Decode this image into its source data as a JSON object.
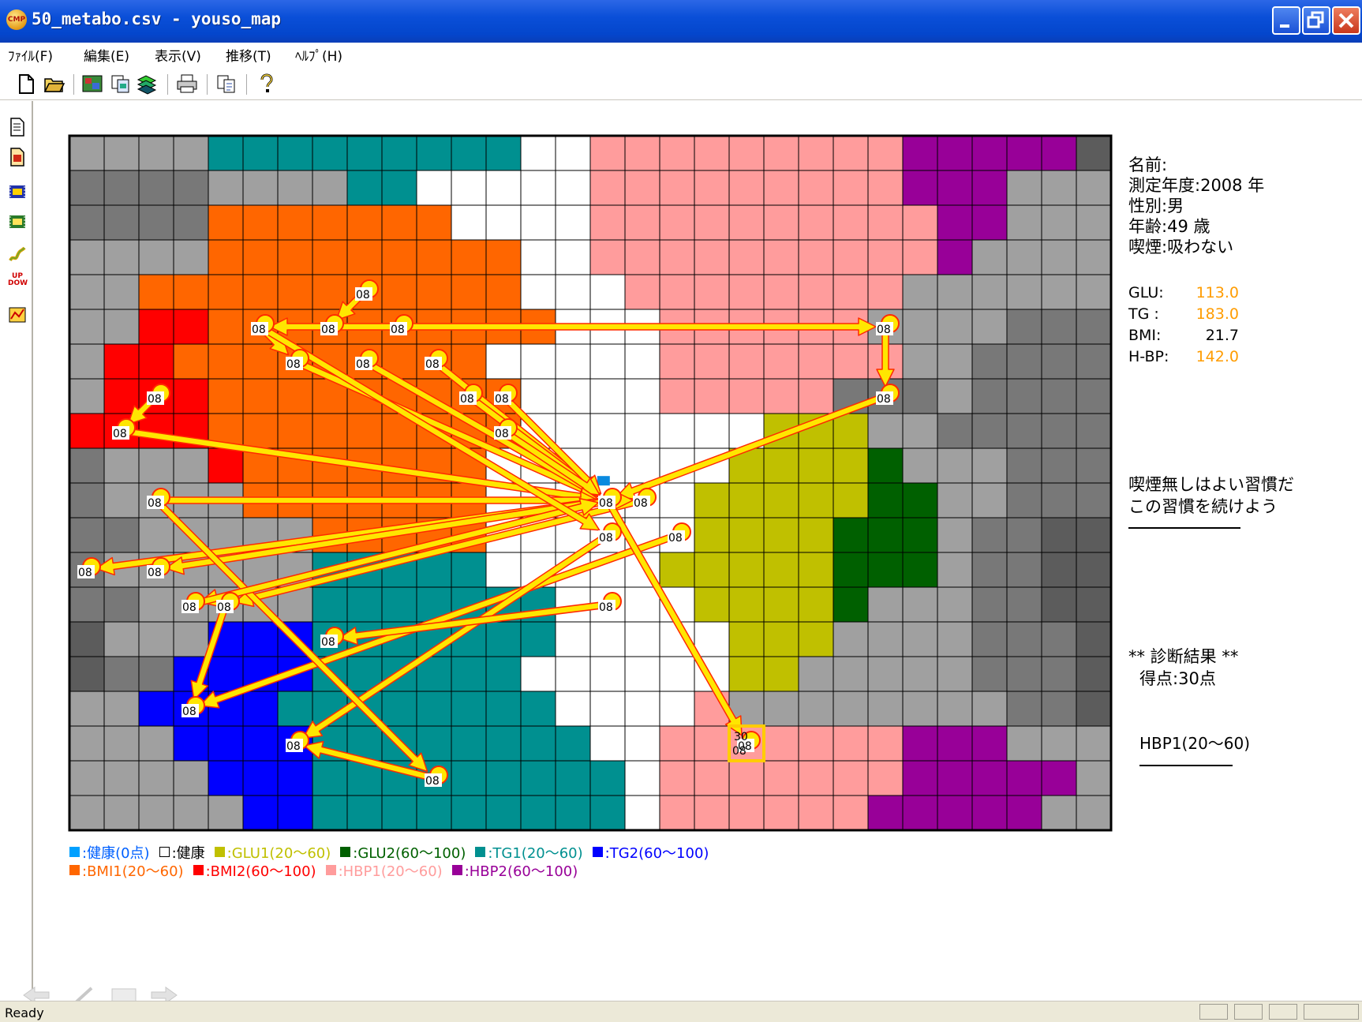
{
  "window": {
    "title": "50_metabo.csv - youso_map",
    "icon": "CMP"
  },
  "menu": [
    "ﾌｧｲﾙ(F)",
    "編集(E)",
    "表示(V)",
    "推移(T)",
    "ﾍﾙﾌﾟ(H)"
  ],
  "toolbar_icons": [
    "new-file-icon",
    "open-folder-icon",
    "map-image-icon",
    "copy-pages-icon",
    "layers-icon",
    "print-icon",
    "copy-icon",
    "help-icon"
  ],
  "sidebar_icons": [
    "page-icon",
    "page-red-icon",
    "film-icon",
    "film-yellow-icon",
    "trend-icon",
    "up-down-icon",
    "chart-icon"
  ],
  "sidebar_updown_text": "UP DOW",
  "colors": {
    "gray_light": "#a0a0a0",
    "gray_mid": "#787878",
    "gray_dark": "#5c5c5c",
    "teal": "#009090",
    "white": "#ffffff",
    "pink": "#ff9c9c",
    "purple": "#980098",
    "orange": "#ff6600",
    "red": "#ff0000",
    "yellow": "#c0c000",
    "green": "#006000",
    "blue": "#0000ff",
    "arrow": "#ffe600",
    "arrow_edge": "#ff2a00"
  },
  "map": {
    "cols": 30,
    "rows": 20,
    "legend_key": {
      "L": "gray_light",
      "M": "gray_mid",
      "D": "gray_dark",
      "T": "teal",
      "W": "white",
      "P": "pink",
      "U": "purple",
      "O": "orange",
      "R": "red",
      "Y": "yellow",
      "G": "green",
      "B": "blue"
    },
    "cells": [
      "LLLLTTTTTTTTTWWPPPPPPPPPUUUUUD",
      "MMMMLLLLTTWWWWWPPPPPPPPPUUULLL",
      "MMMMOOOOOOOWWWWPPPPPPPPPPUULLL",
      "LLLLOOOOOOOOOWWPPPPPPPPPPULLLL",
      "LLOOOOOOOOOOOWWWPPPPPPPPLLLLLL",
      "LLRROOOOOOOOOOWWWPPPPPPLLLLMMM",
      "LRROOOOOOOOOWWWWWPPPPPPPLLMMMM",
      "LRRROOOOOOOOOWWWWPPPPPMMMLMMMM",
      "RRRROOOOOOOOOWWWWWWWYYYLLMMMMM",
      "MLLLROOOOOOOWWWWWWWYYYYGLLLMMM",
      "MLLLLOOOOOOOWWWWWWYYYYYGGLLMMM",
      "MMLLLLLOOOOOWWWWWWYYYYGGGLMMDD",
      "MLLLLLLTTTTTWWWWWYYYYYGGGLMMDD",
      "MMLLLLLTTTTTTTWWWWYYYYGLLLMMDD",
      "DLLLBBBTTTTTTTWWWWWYYYLLLLMMMD",
      "DMMBBBBTTTTTTWWWWWWYYLLLLLMMMD",
      "LLBBBBTTTTTTTTWWWWPLLLLLLLLMMD",
      "LLLBBBBTTTTTTTTWWPPPPPPPUUULLL",
      "LLLLBBBTTTTTTTTTWPPPPPPPUUUUUL",
      "LLLLLBBTTTTTTTTTWPPPPPPUUUUULL"
    ],
    "node_year": "08",
    "final_score_label": "30",
    "nodes": [
      [
        8.5,
        4.5
      ],
      [
        7.5,
        5.5
      ],
      [
        9.5,
        5.5
      ],
      [
        5.5,
        5.5
      ],
      [
        6.5,
        6.5
      ],
      [
        8.5,
        6.5
      ],
      [
        10.5,
        6.5
      ],
      [
        11.5,
        7.5
      ],
      [
        12.5,
        7.5
      ],
      [
        2.5,
        7.5
      ],
      [
        1.5,
        8.5
      ],
      [
        12.5,
        8.5
      ],
      [
        23.5,
        5.5
      ],
      [
        23.5,
        7.5
      ],
      [
        15.5,
        10.5
      ],
      [
        16.5,
        10.5
      ],
      [
        15.5,
        11.5
      ],
      [
        17.5,
        11.5
      ],
      [
        2.5,
        10.5
      ],
      [
        0.5,
        12.5
      ],
      [
        2.5,
        12.5
      ],
      [
        3.5,
        13.5
      ],
      [
        4.5,
        13.5
      ],
      [
        15.5,
        13.5
      ],
      [
        7.5,
        14.5
      ],
      [
        3.5,
        16.5
      ],
      [
        6.5,
        17.5
      ],
      [
        10.5,
        18.5
      ],
      [
        19.5,
        17.5
      ]
    ],
    "arrows": [
      [
        8.5,
        4.5,
        7.5,
        5.5
      ],
      [
        9.5,
        5.5,
        23.5,
        5.5
      ],
      [
        23.5,
        5.5,
        23.5,
        7.5
      ],
      [
        9.5,
        5.5,
        5.5,
        5.5
      ],
      [
        5.5,
        5.5,
        6.5,
        6.5
      ],
      [
        6.5,
        6.5,
        15.5,
        10.5
      ],
      [
        8.5,
        6.5,
        15.5,
        10.5
      ],
      [
        10.5,
        6.5,
        15.5,
        10.5
      ],
      [
        11.5,
        7.5,
        15.5,
        10.5
      ],
      [
        12.5,
        7.5,
        15.5,
        10.5
      ],
      [
        12.5,
        8.5,
        15.5,
        10.5
      ],
      [
        2.5,
        7.5,
        1.5,
        8.5
      ],
      [
        1.5,
        8.5,
        15.5,
        10.5
      ],
      [
        23.5,
        7.5,
        15.5,
        10.5
      ],
      [
        2.5,
        10.5,
        15.5,
        10.5
      ],
      [
        15.5,
        10.5,
        0.5,
        12.5
      ],
      [
        15.5,
        10.5,
        2.5,
        12.5
      ],
      [
        15.5,
        10.5,
        3.5,
        13.5
      ],
      [
        16.5,
        10.5,
        4.5,
        13.5
      ],
      [
        17.5,
        11.5,
        3.5,
        16.5
      ],
      [
        15.5,
        11.5,
        6.5,
        17.5
      ],
      [
        15.5,
        13.5,
        7.5,
        14.5
      ],
      [
        4.5,
        13.5,
        3.5,
        16.5
      ],
      [
        2.5,
        10.5,
        10.5,
        18.5
      ],
      [
        10.5,
        18.5,
        6.5,
        17.5
      ],
      [
        3.5,
        13.5,
        15.5,
        10.5
      ],
      [
        5.5,
        5.5,
        15.5,
        11.5
      ],
      [
        15.5,
        10.5,
        19.5,
        17.5
      ],
      [
        15.5,
        10.5,
        16.5,
        10.5
      ]
    ]
  },
  "info": {
    "name_label": "名前:",
    "name_value": "",
    "year_label": "測定年度:",
    "year_value": "2008",
    "year_unit": "年",
    "sex_label": "性別:",
    "sex_value": "男",
    "age_label": "年齢:",
    "age_value": "49",
    "age_unit": "歳",
    "smoke_label": "喫煙:",
    "smoke_value": "吸わない",
    "glu_label": "GLU:",
    "glu_value": "113.0",
    "tg_label": "TG :",
    "tg_value": "183.0",
    "bmi_label": "BMI:",
    "bmi_value": "21.7",
    "hbp_label": "H-BP:",
    "hbp_value": "142.0",
    "advice_line1": "喫煙無しはよい習慣だ",
    "advice_line2": "この習慣を続けよう",
    "result_title": "** 診断結果 **",
    "score_label": "得点:",
    "score_value": "30",
    "score_unit": "点",
    "category": "HBP1(20～60)",
    "value_colors": {
      "glu": "#ff9c00",
      "tg": "#ff9c00",
      "bmi": "#000000",
      "hbp": "#ff9c00"
    }
  },
  "legend": [
    [
      {
        "text": ":健康(0点)",
        "color": "#00a0ff",
        "text_color": "#0060ff"
      },
      {
        "text": ":健康",
        "color": "#ffffff",
        "text_color": "#000000"
      },
      {
        "text": ":GLU1(20～60)",
        "color": "#c0c000",
        "text_color": "#c0c000"
      },
      {
        "text": ":GLU2(60～100)",
        "color": "#006000",
        "text_color": "#006000"
      },
      {
        "text": ":TG1(20～60)",
        "color": "#009090",
        "text_color": "#009090"
      },
      {
        "text": ":TG2(60～100)",
        "color": "#0000ff",
        "text_color": "#0000ff"
      }
    ],
    [
      {
        "text": ":BMI1(20～60)",
        "color": "#ff6600",
        "text_color": "#ff6600"
      },
      {
        "text": ":BMI2(60～100)",
        "color": "#ff0000",
        "text_color": "#ff0000"
      },
      {
        "text": ":HBP1(20～60)",
        "color": "#ff9c9c",
        "text_color": "#ff9c9c"
      },
      {
        "text": ":HBP2(60～100)",
        "color": "#980098",
        "text_color": "#980098"
      }
    ]
  ],
  "status": {
    "text": "Ready"
  }
}
